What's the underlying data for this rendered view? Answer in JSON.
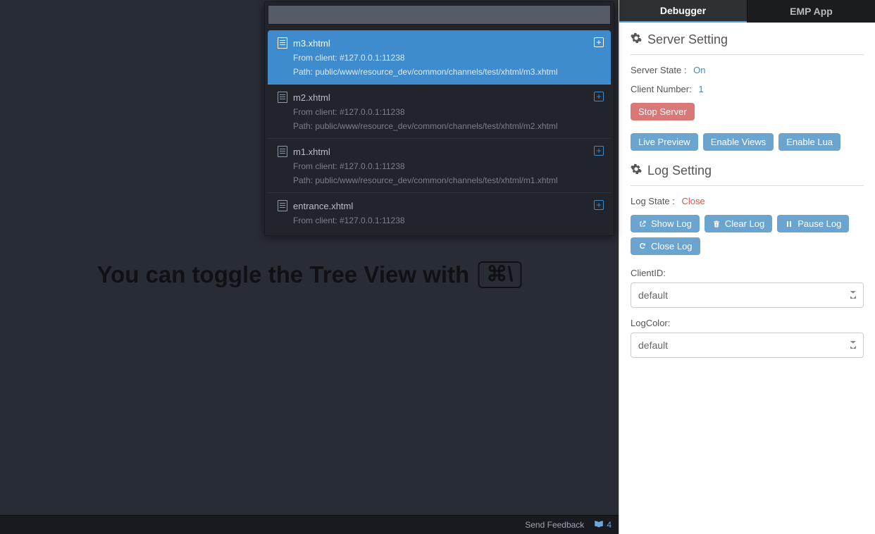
{
  "editor": {
    "hint_prefix": "You can toggle the Tree View with",
    "hint_key": "⌘\\"
  },
  "palette": {
    "search_value": "",
    "items": [
      {
        "title": "m3.xhtml",
        "from": "From client: #127.0.0.1:11238",
        "path": "Path: public/www/resource_dev/common/channels/test/xhtml/m3.xhtml",
        "selected": true
      },
      {
        "title": "m2.xhtml",
        "from": "From client: #127.0.0.1:11238",
        "path": "Path: public/www/resource_dev/common/channels/test/xhtml/m2.xhtml",
        "selected": false
      },
      {
        "title": "m1.xhtml",
        "from": "From client: #127.0.0.1:11238",
        "path": "Path: public/www/resource_dev/common/channels/test/xhtml/m1.xhtml",
        "selected": false
      },
      {
        "title": "entrance.xhtml",
        "from": "From client: #127.0.0.1:11238",
        "path": "",
        "selected": false
      }
    ]
  },
  "status": {
    "feedback": "Send Feedback",
    "notifications_count": "4"
  },
  "tabs": {
    "debugger": "Debugger",
    "emp": "EMP App"
  },
  "server": {
    "section_title": "Server Setting",
    "state_label": "Server State :",
    "state_value": "On",
    "client_label": "Client Number:",
    "client_value": "1",
    "stop_btn": "Stop Server",
    "live_preview": "Live Preview",
    "enable_views": "Enable Views",
    "enable_lua": "Enable Lua"
  },
  "log": {
    "section_title": "Log Setting",
    "state_label": "Log State :",
    "state_value": "Close",
    "show_log": "Show Log",
    "clear_log": "Clear Log",
    "pause_log": "Pause Log",
    "close_log": "Close Log",
    "clientid_label": "ClientID:",
    "clientid_value": "default",
    "logcolor_label": "LogColor:",
    "logcolor_value": "default"
  }
}
